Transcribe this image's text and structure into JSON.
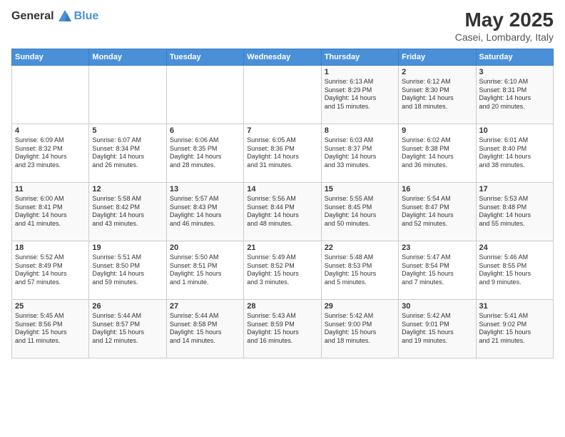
{
  "header": {
    "logo_general": "General",
    "logo_blue": "Blue",
    "month": "May 2025",
    "location": "Casei, Lombardy, Italy"
  },
  "weekdays": [
    "Sunday",
    "Monday",
    "Tuesday",
    "Wednesday",
    "Thursday",
    "Friday",
    "Saturday"
  ],
  "weeks": [
    [
      {
        "day": "",
        "info": ""
      },
      {
        "day": "",
        "info": ""
      },
      {
        "day": "",
        "info": ""
      },
      {
        "day": "",
        "info": ""
      },
      {
        "day": "1",
        "info": "Sunrise: 6:13 AM\nSunset: 8:29 PM\nDaylight: 14 hours\nand 15 minutes."
      },
      {
        "day": "2",
        "info": "Sunrise: 6:12 AM\nSunset: 8:30 PM\nDaylight: 14 hours\nand 18 minutes."
      },
      {
        "day": "3",
        "info": "Sunrise: 6:10 AM\nSunset: 8:31 PM\nDaylight: 14 hours\nand 20 minutes."
      }
    ],
    [
      {
        "day": "4",
        "info": "Sunrise: 6:09 AM\nSunset: 8:32 PM\nDaylight: 14 hours\nand 23 minutes."
      },
      {
        "day": "5",
        "info": "Sunrise: 6:07 AM\nSunset: 8:34 PM\nDaylight: 14 hours\nand 26 minutes."
      },
      {
        "day": "6",
        "info": "Sunrise: 6:06 AM\nSunset: 8:35 PM\nDaylight: 14 hours\nand 28 minutes."
      },
      {
        "day": "7",
        "info": "Sunrise: 6:05 AM\nSunset: 8:36 PM\nDaylight: 14 hours\nand 31 minutes."
      },
      {
        "day": "8",
        "info": "Sunrise: 6:03 AM\nSunset: 8:37 PM\nDaylight: 14 hours\nand 33 minutes."
      },
      {
        "day": "9",
        "info": "Sunrise: 6:02 AM\nSunset: 8:38 PM\nDaylight: 14 hours\nand 36 minutes."
      },
      {
        "day": "10",
        "info": "Sunrise: 6:01 AM\nSunset: 8:40 PM\nDaylight: 14 hours\nand 38 minutes."
      }
    ],
    [
      {
        "day": "11",
        "info": "Sunrise: 6:00 AM\nSunset: 8:41 PM\nDaylight: 14 hours\nand 41 minutes."
      },
      {
        "day": "12",
        "info": "Sunrise: 5:58 AM\nSunset: 8:42 PM\nDaylight: 14 hours\nand 43 minutes."
      },
      {
        "day": "13",
        "info": "Sunrise: 5:57 AM\nSunset: 8:43 PM\nDaylight: 14 hours\nand 46 minutes."
      },
      {
        "day": "14",
        "info": "Sunrise: 5:56 AM\nSunset: 8:44 PM\nDaylight: 14 hours\nand 48 minutes."
      },
      {
        "day": "15",
        "info": "Sunrise: 5:55 AM\nSunset: 8:45 PM\nDaylight: 14 hours\nand 50 minutes."
      },
      {
        "day": "16",
        "info": "Sunrise: 5:54 AM\nSunset: 8:47 PM\nDaylight: 14 hours\nand 52 minutes."
      },
      {
        "day": "17",
        "info": "Sunrise: 5:53 AM\nSunset: 8:48 PM\nDaylight: 14 hours\nand 55 minutes."
      }
    ],
    [
      {
        "day": "18",
        "info": "Sunrise: 5:52 AM\nSunset: 8:49 PM\nDaylight: 14 hours\nand 57 minutes."
      },
      {
        "day": "19",
        "info": "Sunrise: 5:51 AM\nSunset: 8:50 PM\nDaylight: 14 hours\nand 59 minutes."
      },
      {
        "day": "20",
        "info": "Sunrise: 5:50 AM\nSunset: 8:51 PM\nDaylight: 15 hours\nand 1 minute."
      },
      {
        "day": "21",
        "info": "Sunrise: 5:49 AM\nSunset: 8:52 PM\nDaylight: 15 hours\nand 3 minutes."
      },
      {
        "day": "22",
        "info": "Sunrise: 5:48 AM\nSunset: 8:53 PM\nDaylight: 15 hours\nand 5 minutes."
      },
      {
        "day": "23",
        "info": "Sunrise: 5:47 AM\nSunset: 8:54 PM\nDaylight: 15 hours\nand 7 minutes."
      },
      {
        "day": "24",
        "info": "Sunrise: 5:46 AM\nSunset: 8:55 PM\nDaylight: 15 hours\nand 9 minutes."
      }
    ],
    [
      {
        "day": "25",
        "info": "Sunrise: 5:45 AM\nSunset: 8:56 PM\nDaylight: 15 hours\nand 11 minutes."
      },
      {
        "day": "26",
        "info": "Sunrise: 5:44 AM\nSunset: 8:57 PM\nDaylight: 15 hours\nand 12 minutes."
      },
      {
        "day": "27",
        "info": "Sunrise: 5:44 AM\nSunset: 8:58 PM\nDaylight: 15 hours\nand 14 minutes."
      },
      {
        "day": "28",
        "info": "Sunrise: 5:43 AM\nSunset: 8:59 PM\nDaylight: 15 hours\nand 16 minutes."
      },
      {
        "day": "29",
        "info": "Sunrise: 5:42 AM\nSunset: 9:00 PM\nDaylight: 15 hours\nand 18 minutes."
      },
      {
        "day": "30",
        "info": "Sunrise: 5:42 AM\nSunset: 9:01 PM\nDaylight: 15 hours\nand 19 minutes."
      },
      {
        "day": "31",
        "info": "Sunrise: 5:41 AM\nSunset: 9:02 PM\nDaylight: 15 hours\nand 21 minutes."
      }
    ]
  ]
}
